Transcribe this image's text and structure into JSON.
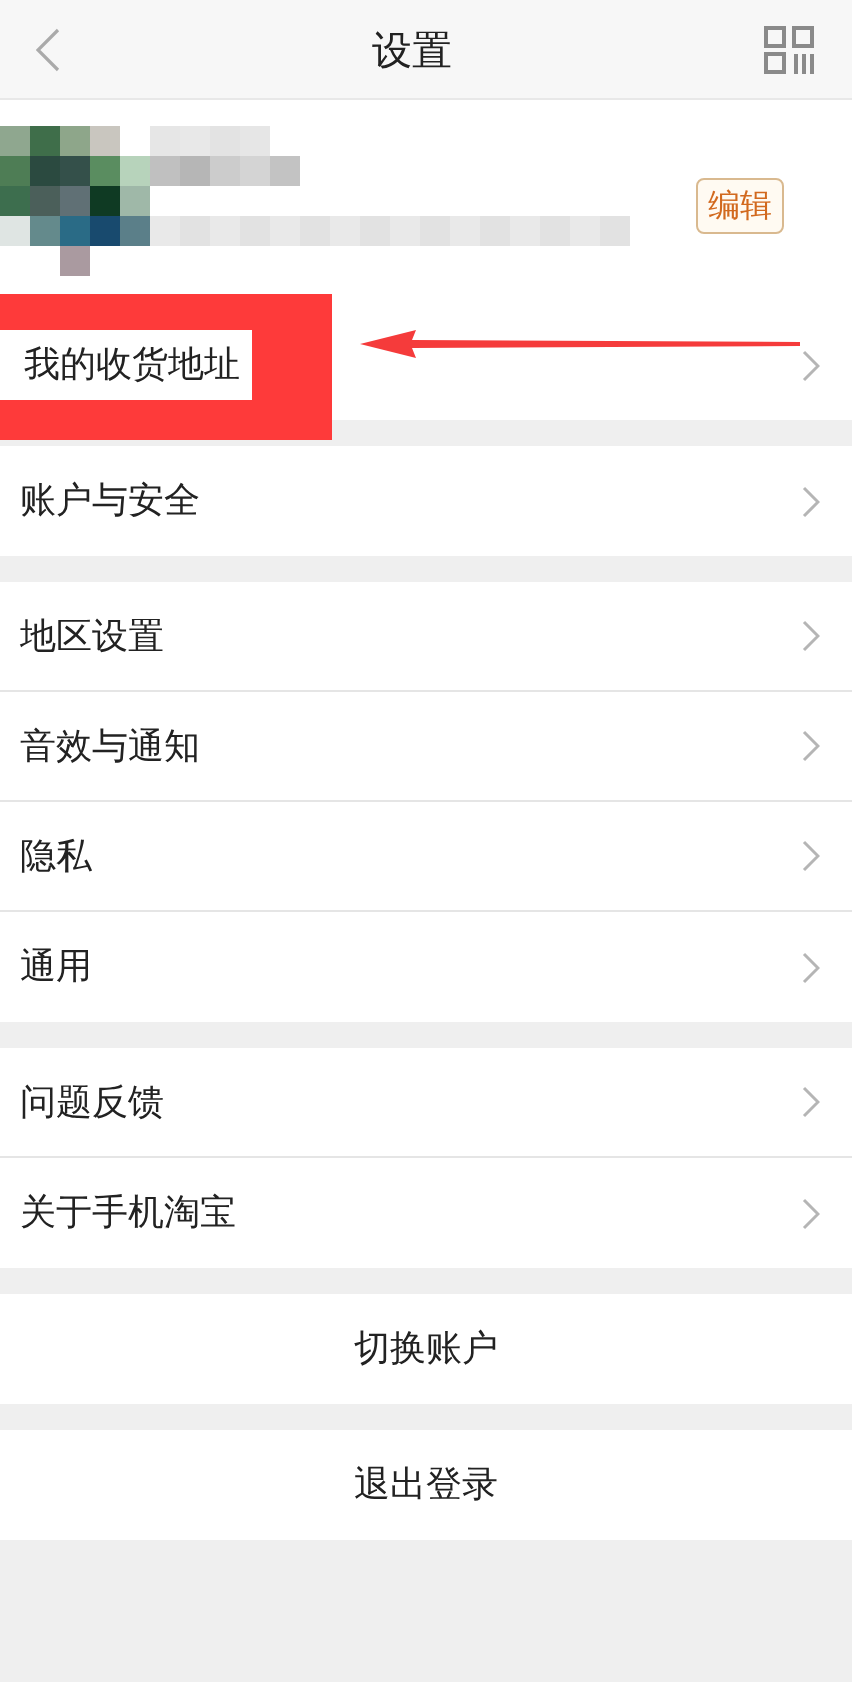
{
  "header": {
    "title": "设置"
  },
  "profile": {
    "edit_button": "编辑"
  },
  "groups": [
    {
      "items": [
        {
          "label": "我的收货地址",
          "kind": "link",
          "highlighted": true
        }
      ]
    },
    {
      "items": [
        {
          "label": "账户与安全",
          "kind": "link",
          "highlighted": false
        }
      ]
    },
    {
      "items": [
        {
          "label": "地区设置",
          "kind": "link",
          "highlighted": false
        },
        {
          "label": "音效与通知",
          "kind": "link",
          "highlighted": false
        },
        {
          "label": "隐私",
          "kind": "link",
          "highlighted": false
        },
        {
          "label": "通用",
          "kind": "link",
          "highlighted": false
        }
      ]
    },
    {
      "items": [
        {
          "label": "问题反馈",
          "kind": "link",
          "highlighted": false
        },
        {
          "label": "关于手机淘宝",
          "kind": "link",
          "highlighted": false
        }
      ]
    },
    {
      "items": [
        {
          "label": "切换账户",
          "kind": "action"
        }
      ]
    },
    {
      "items": [
        {
          "label": "退出登录",
          "kind": "action"
        }
      ]
    }
  ]
}
